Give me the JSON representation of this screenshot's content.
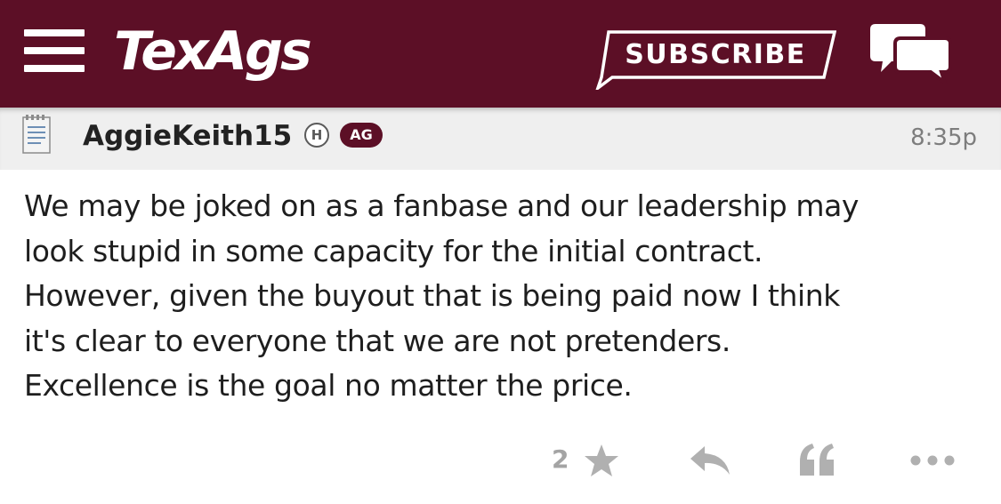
{
  "header": {
    "logo_text": "TexAgs",
    "subscribe_label": "SUBSCRIBE",
    "menu_icon": "hamburger-menu-icon",
    "chat_icon": "chat-bubbles-icon",
    "background_color": "#5c0f26"
  },
  "post": {
    "user_icon": "notepad-icon",
    "username": "AggieKeith15",
    "badges": [
      "H",
      "AG"
    ],
    "time": "8:35p",
    "body_lines": [
      "We may be joked on as a fanbase and our leadership may",
      "look stupid in some capacity for the initial contract.",
      "However, given the buyout that is being paid now I think",
      "it's clear to everyone that we are not pretenders.",
      "Excellence is the goal no matter the price."
    ],
    "actions": {
      "star_count": "2",
      "star_icon": "star-icon",
      "reply_icon": "reply-icon",
      "quote_icon": "quote-icon",
      "more_icon": "more-options-icon"
    }
  }
}
